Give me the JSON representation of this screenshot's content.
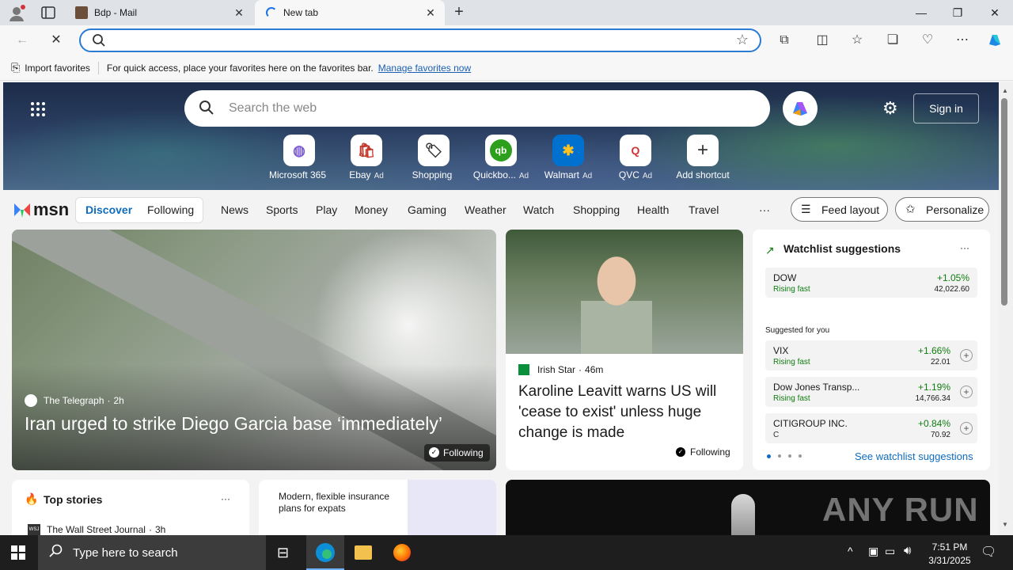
{
  "tabs": [
    {
      "title": "Bdp - Mail"
    },
    {
      "title": "New tab"
    }
  ],
  "addressbar": {
    "value": ""
  },
  "favorites_bar": {
    "import_label": "Import favorites",
    "message": "For quick access, place your favorites here on the favorites bar.",
    "manage_link": "Manage favorites now"
  },
  "msn": {
    "search_placeholder": "Search the web",
    "sign_in": "Sign in",
    "shortcuts": [
      {
        "label": "Microsoft 365",
        "ad": ""
      },
      {
        "label": "Ebay",
        "ad": "Ad"
      },
      {
        "label": "Shopping",
        "ad": ""
      },
      {
        "label": "Quickbo...",
        "ad": "Ad"
      },
      {
        "label": "Walmart",
        "ad": "Ad"
      },
      {
        "label": "QVC",
        "ad": "Ad"
      },
      {
        "label": "Add shortcut",
        "ad": ""
      }
    ],
    "logo": "msn",
    "nav": {
      "discover": "Discover",
      "following": "Following",
      "items": [
        "News",
        "Sports",
        "Play",
        "Money",
        "Gaming",
        "Weather",
        "Watch",
        "Shopping",
        "Health",
        "Travel"
      ],
      "more": "···",
      "feed_layout": "Feed layout",
      "personalize": "Personalize"
    },
    "hero_story": {
      "source": "The Telegraph",
      "age": "2h",
      "headline": "Iran urged to strike Diego Garcia base ‘immediately’",
      "following": "Following"
    },
    "second_story": {
      "source": "Irish Star",
      "age": "46m",
      "headline": "Karoline Leavitt warns US will 'cease to exist' unless huge change is made",
      "following": "Following"
    },
    "watchlist": {
      "title": "Watchlist suggestions",
      "more": "···",
      "top": {
        "name": "DOW",
        "sub": "Rising fast",
        "pct": "+1.05%",
        "val": "42,022.60"
      },
      "suggested_label": "Suggested for you",
      "items": [
        {
          "name": "VIX",
          "sub": "Rising fast",
          "pct": "+1.66%",
          "val": "22.01"
        },
        {
          "name": "Dow Jones Transp...",
          "sub": "Rising fast",
          "pct": "+1.19%",
          "val": "14,766.34"
        },
        {
          "name": "CITIGROUP INC.",
          "sub": "C",
          "pct": "+0.84%",
          "val": "70.92"
        }
      ],
      "see_more": "See watchlist suggestions"
    },
    "top_stories": {
      "title": "Top stories",
      "more": "···",
      "first_source": "The Wall Street Journal",
      "first_age": "3h",
      "wsj_badge": "WSJ"
    },
    "ad_card": {
      "text": "Modern, flexible insurance plans for expats"
    },
    "watermark": "ANY RUN"
  },
  "taskbar": {
    "search_placeholder": "Type here to search",
    "time": "7:51 PM",
    "date": "3/31/2025"
  }
}
